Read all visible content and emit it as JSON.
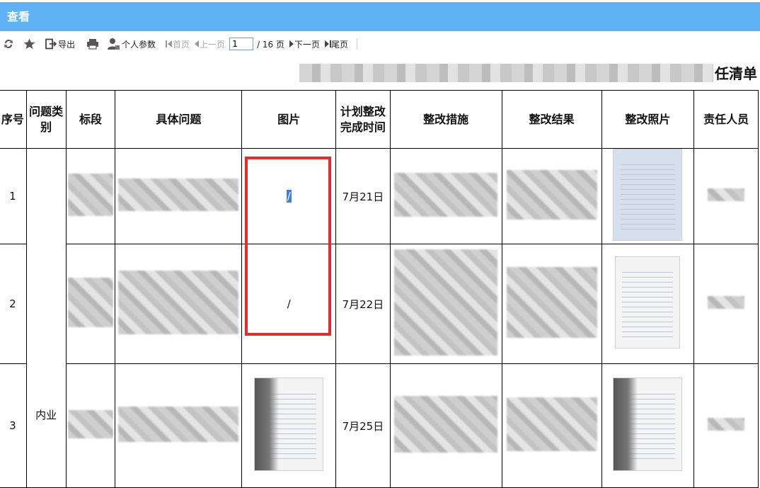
{
  "window": {
    "title": "查看"
  },
  "toolbar": {
    "export_label": "导出",
    "personal_params_label": "个人参数",
    "first_page_label": "首页",
    "prev_page_label": "上一页",
    "page_input_value": "1",
    "page_total": "/ 16 页",
    "next_page_label": "下一页",
    "last_page_label": "尾页"
  },
  "report": {
    "title_suffix": "任清单"
  },
  "table": {
    "headers": {
      "seq": "序号",
      "category": "问题类别",
      "section": "标段",
      "issue": "具体问题",
      "image": "图片",
      "plan_date": "计划整改完成时间",
      "measures": "整改措施",
      "result": "整改结果",
      "photo": "整改照片",
      "person": "责任人员"
    },
    "category_value": "内业",
    "rows": [
      {
        "seq": "1",
        "image": "/",
        "date": "7月21日"
      },
      {
        "seq": "2",
        "image": "/",
        "date": "7月22日"
      },
      {
        "seq": "3",
        "image": "",
        "date": "7月25日"
      }
    ]
  },
  "colors": {
    "titlebar": "#5fb1f5",
    "highlight_box": "#e52c2c",
    "selection": "#3d7ee0"
  },
  "icons": [
    "refresh-icon",
    "star-icon",
    "export-icon",
    "print-icon",
    "user-settings-icon",
    "first-page-icon",
    "prev-page-icon",
    "next-page-icon",
    "last-page-icon"
  ]
}
